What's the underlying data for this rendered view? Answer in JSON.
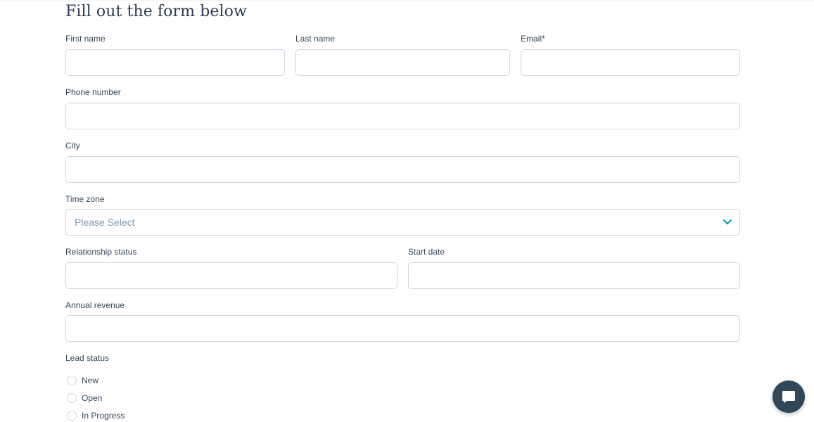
{
  "form": {
    "title": "Fill out the form below",
    "fields": {
      "first_name": {
        "label": "First name",
        "value": "",
        "placeholder": ""
      },
      "last_name": {
        "label": "Last name",
        "value": "",
        "placeholder": ""
      },
      "email": {
        "label": "Email*",
        "value": "",
        "placeholder": ""
      },
      "phone": {
        "label": "Phone number",
        "value": "",
        "placeholder": ""
      },
      "city": {
        "label": "City",
        "value": "",
        "placeholder": ""
      },
      "time_zone": {
        "label": "Time zone",
        "selected": "Please Select"
      },
      "relationship_status": {
        "label": "Relationship status",
        "value": "",
        "placeholder": ""
      },
      "start_date": {
        "label": "Start date",
        "value": "",
        "placeholder": ""
      },
      "annual_revenue": {
        "label": "Annual revenue",
        "value": "",
        "placeholder": ""
      }
    },
    "lead_status": {
      "label": "Lead status",
      "options": [
        "New",
        "Open",
        "In Progress"
      ]
    }
  },
  "icons": {
    "select_chevron": "chevron-down-icon",
    "chat": "chat-bubble-icon"
  },
  "colors": {
    "accent": "#0091ae",
    "text": "#33475b",
    "border": "#cbd6e2",
    "placeholder": "#7c98b6",
    "chat_button": "#33475b"
  }
}
